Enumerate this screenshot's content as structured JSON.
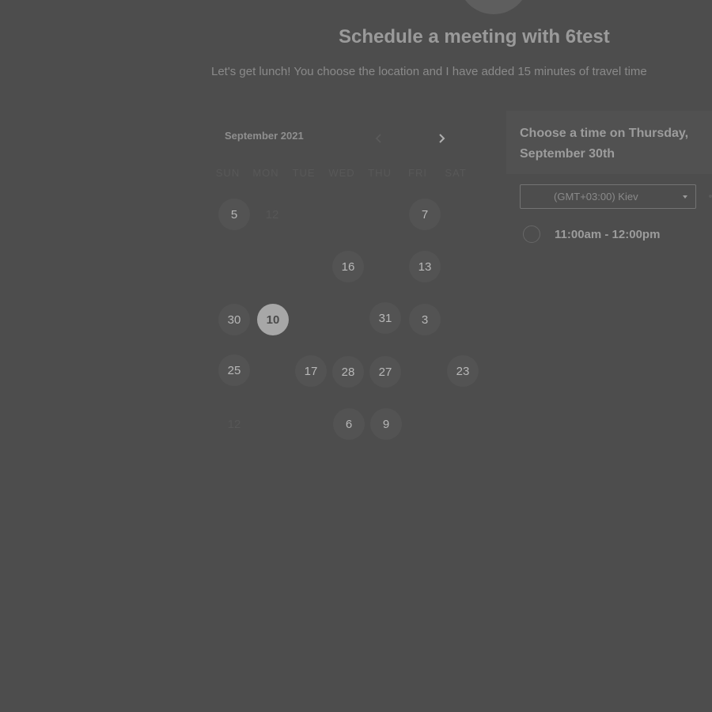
{
  "header": {
    "title": "Schedule a meeting with 6test",
    "subtitle": "Let's get lunch! You choose the location and I have added 15 minutes of travel time"
  },
  "calendar": {
    "month_label": "September 2021",
    "weekdays": [
      "SUN",
      "MON",
      "TUE",
      "WED",
      "THU",
      "FRI",
      "SAT"
    ],
    "prev_icon": "chevron-left-icon",
    "next_icon": "chevron-right-icon",
    "days": [
      {
        "label": "5",
        "state": "available"
      },
      {
        "label": "12",
        "state": "disabled"
      },
      {
        "label": "7",
        "state": "available"
      },
      {
        "label": "16",
        "state": "available"
      },
      {
        "label": "13",
        "state": "available"
      },
      {
        "label": "30",
        "state": "available"
      },
      {
        "label": "10",
        "state": "selected"
      },
      {
        "label": "31",
        "state": "available"
      },
      {
        "label": "3",
        "state": "available"
      },
      {
        "label": "25",
        "state": "available"
      },
      {
        "label": "17",
        "state": "available"
      },
      {
        "label": "28",
        "state": "available"
      },
      {
        "label": "27",
        "state": "available"
      },
      {
        "label": "23",
        "state": "available"
      },
      {
        "label": "12",
        "state": "disabled"
      },
      {
        "label": "6",
        "state": "available"
      },
      {
        "label": "9",
        "state": "available"
      }
    ]
  },
  "panel": {
    "title": "Choose a time on Thursday, September 30th",
    "timezone": "(GMT+03:00) Kiev",
    "slots": [
      {
        "label": "11:00am - 12:00pm"
      }
    ]
  },
  "colors": {
    "background": "#4d4d4d",
    "selected_day": "#a7a7a7",
    "day_bubble": "#535353"
  }
}
